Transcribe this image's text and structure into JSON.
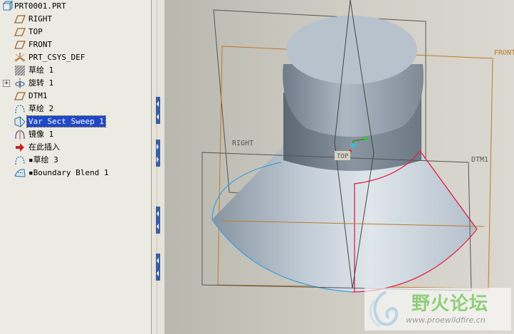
{
  "tree": {
    "root": "PRT0001.PRT",
    "items": [
      {
        "label": "RIGHT",
        "icon": "datum-plane-icon"
      },
      {
        "label": "TOP",
        "icon": "datum-plane-icon"
      },
      {
        "label": "FRONT",
        "icon": "datum-plane-icon"
      },
      {
        "label": "PRT_CSYS_DEF",
        "icon": "csys-icon"
      },
      {
        "label": "草绘 1",
        "icon": "sketch-icon"
      },
      {
        "label": "旋转 1",
        "icon": "revolve-icon"
      },
      {
        "label": "DTM1",
        "icon": "datum-plane-icon"
      },
      {
        "label": "草绘 2",
        "icon": "datum-curve-icon"
      },
      {
        "label": "Var Sect Sweep 1",
        "icon": "var-sect-sweep-icon",
        "selected": true
      },
      {
        "label": "镜像 1",
        "icon": "mirror-icon"
      },
      {
        "label": "在此插入",
        "icon": "insert-here-arrow-icon"
      },
      {
        "label": "▪草绘 3",
        "icon": "datum-curve-icon"
      },
      {
        "label": "▪Boundary Blend 1",
        "icon": "boundary-blend-icon"
      }
    ]
  },
  "viewport": {
    "labels": {
      "front": "FRONT",
      "right": "RIGHT",
      "top": "TOP",
      "dtm1": "DTM1"
    }
  },
  "watermark": {
    "name": "野火论坛",
    "url": "www.proewildfire.cn"
  },
  "colors": {
    "datum": "#c07a2a",
    "edge": "#e0204a",
    "curve": "#3aa0e0",
    "selection": "#1f48c8"
  }
}
